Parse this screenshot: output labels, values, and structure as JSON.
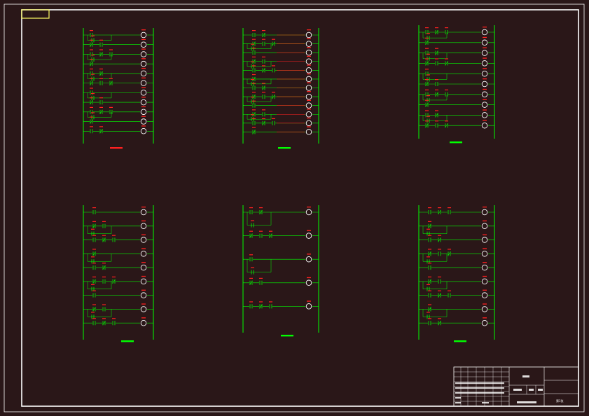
{
  "drawing": {
    "colors": {
      "background": "#2a1718",
      "frame": "#ffffff",
      "rail": "#00ff00",
      "contact": "#00ff00",
      "coil": "#ffffff",
      "label": "#ff2020",
      "connection_red": "#ff2020",
      "corner_tab": "#ffff66"
    },
    "diagrams": [
      {
        "id": "d1",
        "rungs": 11,
        "title_color": "#ff2020"
      },
      {
        "id": "d2",
        "rungs": 12,
        "title_color": "#00ff00"
      },
      {
        "id": "d3",
        "rungs": 10,
        "title_color": "#00ff00"
      },
      {
        "id": "d4",
        "rungs": 9,
        "title_color": "#00ff00"
      },
      {
        "id": "d5",
        "rungs": 5,
        "title_color": "#00ff00"
      },
      {
        "id": "d6",
        "rungs": 9,
        "title_color": "#00ff00"
      }
    ],
    "title_block": {
      "sheet_label": "第1张",
      "icon": "title-block-grid"
    }
  }
}
